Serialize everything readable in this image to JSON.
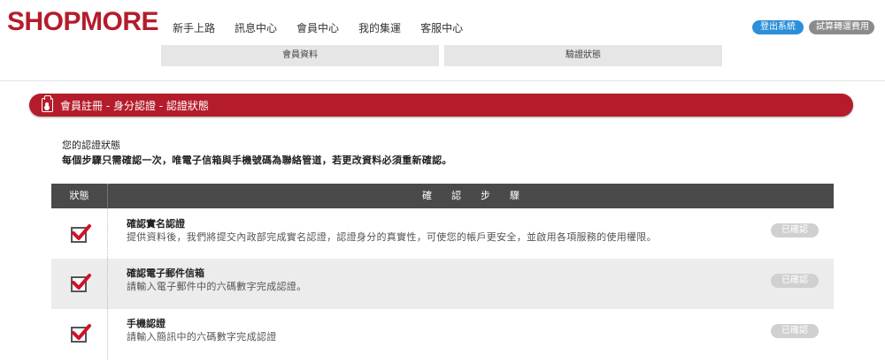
{
  "brand": {
    "logo": "SHOPMORE",
    "color": "#b51c2b"
  },
  "nav": {
    "items": [
      "新手上路",
      "訊息中心",
      "會員中心",
      "我的集運",
      "客服中心"
    ]
  },
  "header_buttons": {
    "login": "登出系統",
    "fee": "試算轉運費用"
  },
  "subtabs": [
    "會員資料",
    "驗證狀態"
  ],
  "banner": {
    "icon": "clipboard-icon",
    "text": "會員註冊 - 身分認證 - 認證狀態"
  },
  "intro": {
    "title": "您的認證狀態",
    "desc": "每個步驟只需確認一次，唯電子信箱與手機號碼為聯絡管道，若更改資料必須重新確認。"
  },
  "table": {
    "headers": {
      "status": "狀態",
      "steps": "確認步驟"
    },
    "rows": [
      {
        "title": "確認實名認證",
        "desc": "提供資料後，我們將提交內政部完成實名認證，認證身分的真實性，可使您的帳戶更安全，並啟用各項服務的使用權限。",
        "badge": "已確認",
        "checked": true
      },
      {
        "title": "確認電子郵件信箱",
        "desc": "請輸入電子郵件中的六碼數字完成認證。",
        "badge": "已確認",
        "checked": true
      },
      {
        "title": "手機認證",
        "desc": "請輸入簡訊中的六碼數字完成認證",
        "badge": "已確認",
        "checked": true
      }
    ]
  }
}
